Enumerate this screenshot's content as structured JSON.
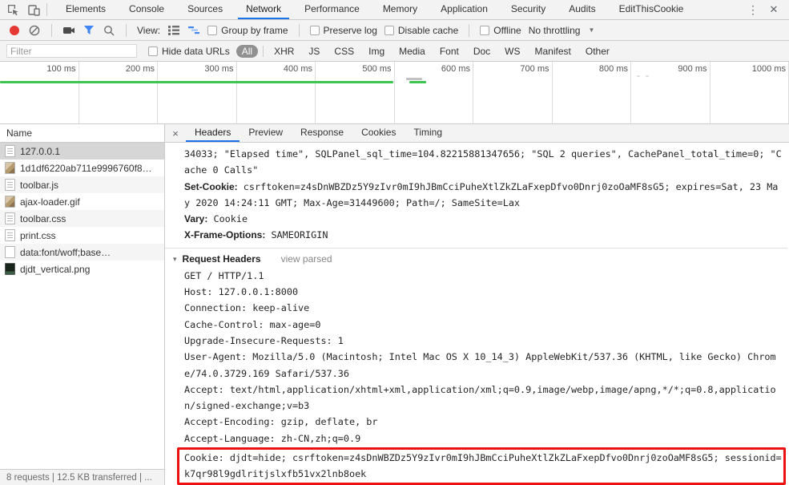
{
  "window": {
    "tabs": [
      "Elements",
      "Console",
      "Sources",
      "Network",
      "Performance",
      "Memory",
      "Application",
      "Security",
      "Audits",
      "EditThisCookie"
    ],
    "selected_tab": "Network",
    "menu_icon": "⋮",
    "close_icon": "✕"
  },
  "toolbar": {
    "view_label": "View:",
    "group_by_frame": "Group by frame",
    "preserve_log": "Preserve log",
    "disable_cache": "Disable cache",
    "offline": "Offline",
    "throttling": "No throttling",
    "caret": "▼"
  },
  "filterbar": {
    "placeholder": "Filter",
    "hide_data_urls": "Hide data URLs",
    "types": [
      "All",
      "XHR",
      "JS",
      "CSS",
      "Img",
      "Media",
      "Font",
      "Doc",
      "WS",
      "Manifest",
      "Other"
    ],
    "selected_type": "All"
  },
  "timeline": {
    "ticks": [
      "100 ms",
      "200 ms",
      "300 ms",
      "400 ms",
      "500 ms",
      "600 ms",
      "700 ms",
      "800 ms",
      "900 ms",
      "1000 ms"
    ]
  },
  "sidebar": {
    "header": "Name",
    "rows": [
      {
        "name": "127.0.0.1",
        "icon": "doc",
        "selected": true
      },
      {
        "name": "1d1df6220ab711e9996760f8…",
        "icon": "img"
      },
      {
        "name": "toolbar.js",
        "icon": "doc"
      },
      {
        "name": "ajax-loader.gif",
        "icon": "img"
      },
      {
        "name": "toolbar.css",
        "icon": "doc"
      },
      {
        "name": "print.css",
        "icon": "doc"
      },
      {
        "name": "data:font/woff;base…",
        "icon": "plain"
      },
      {
        "name": "djdt_vertical.png",
        "icon": "imgdark"
      }
    ],
    "status": "8 requests | 12.5 KB transferred | ..."
  },
  "details": {
    "close_icon": "×",
    "tabs": [
      "Headers",
      "Preview",
      "Response",
      "Cookies",
      "Timing"
    ],
    "selected_tab": "Headers",
    "response_lines": [
      {
        "t": "34033; \"Elapsed time\", SQLPanel_sql_time=104.82215881347656; \"SQL 2 queries\", CachePanel_total_time=0; \"C"
      },
      {
        "t": "ache 0 Calls\""
      },
      {
        "b": "Set-Cookie:",
        "t": " csrftoken=z4sDnWBZDz5Y9zIvr0mI9hJBmCciPuheXtlZkZLaFxepDfvo0Dnrj0zoOaMF8sG5; expires=Sat, 23 Ma"
      },
      {
        "t": "y 2020 14:24:11 GMT; Max-Age=31449600; Path=/; SameSite=Lax"
      },
      {
        "b": "Vary:",
        "t": " Cookie"
      },
      {
        "b": "X-Frame-Options:",
        "t": " SAMEORIGIN"
      }
    ],
    "request_section": {
      "triangle": "▾",
      "title": "Request Headers",
      "action": "view parsed"
    },
    "request_lines": [
      "GET / HTTP/1.1",
      "Host: 127.0.0.1:8000",
      "Connection: keep-alive",
      "Cache-Control: max-age=0",
      "Upgrade-Insecure-Requests: 1",
      "User-Agent: Mozilla/5.0 (Macintosh; Intel Mac OS X 10_14_3) AppleWebKit/537.36 (KHTML, like Gecko) Chrom",
      "e/74.0.3729.169 Safari/537.36",
      "Accept: text/html,application/xhtml+xml,application/xml;q=0.9,image/webp,image/apng,*/*;q=0.8,applicatio",
      "n/signed-exchange;v=b3",
      "Accept-Encoding: gzip, deflate, br",
      "Accept-Language: zh-CN,zh;q=0.9"
    ],
    "highlighted_lines": [
      "Cookie: djdt=hide; csrftoken=z4sDnWBZDz5Y9zIvr0mI9hJBmCciPuheXtlZkZLaFxepDfvo0Dnrj0zoOaMF8sG5; sessionid=",
      "k7qr98l9gdlritjslxfb51vx2lnb8oek"
    ]
  },
  "colors": {
    "accent": "#1a73e8",
    "record_red": "#e53935",
    "funnel_blue": "#4285f4",
    "waterfall_green": "#3dc451",
    "highlight_red": "#ee1111"
  }
}
